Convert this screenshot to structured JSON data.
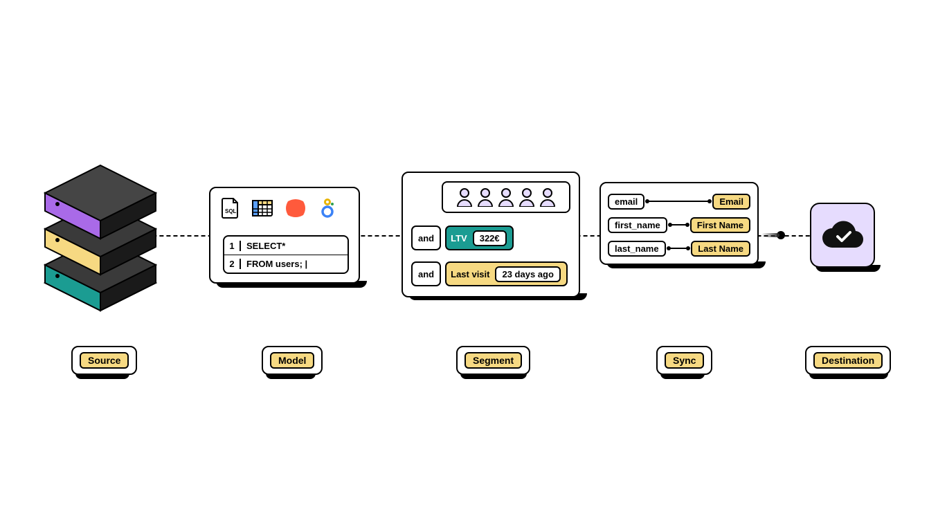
{
  "labels": {
    "source": "Source",
    "model": "Model",
    "segment": "Segment",
    "sync": "Sync",
    "destination": "Destination"
  },
  "source": {
    "layer_colors": [
      "#a96ae8",
      "#f6d982",
      "#1b9c92"
    ]
  },
  "model": {
    "icons": [
      "sql-file-icon",
      "spreadsheet-icon",
      "dbt-icon",
      "looker-icon"
    ],
    "code": [
      {
        "n": "1",
        "text": "SELECT*"
      },
      {
        "n": "2",
        "text": "FROM users; |"
      }
    ]
  },
  "segment": {
    "people_count": 5,
    "clauses": [
      {
        "op": "and",
        "key": "LTV",
        "value": "322€",
        "style": "ltv"
      },
      {
        "op": "and",
        "key": "Last visit",
        "value": "23 days ago",
        "style": "visit"
      }
    ]
  },
  "sync": {
    "mappings": [
      {
        "src": "email",
        "dst": "Email"
      },
      {
        "src": "first_name",
        "dst": "First Name"
      },
      {
        "src": "last_name",
        "dst": "Last Name"
      }
    ]
  },
  "destination": {
    "icon": "cloud-check-icon"
  }
}
